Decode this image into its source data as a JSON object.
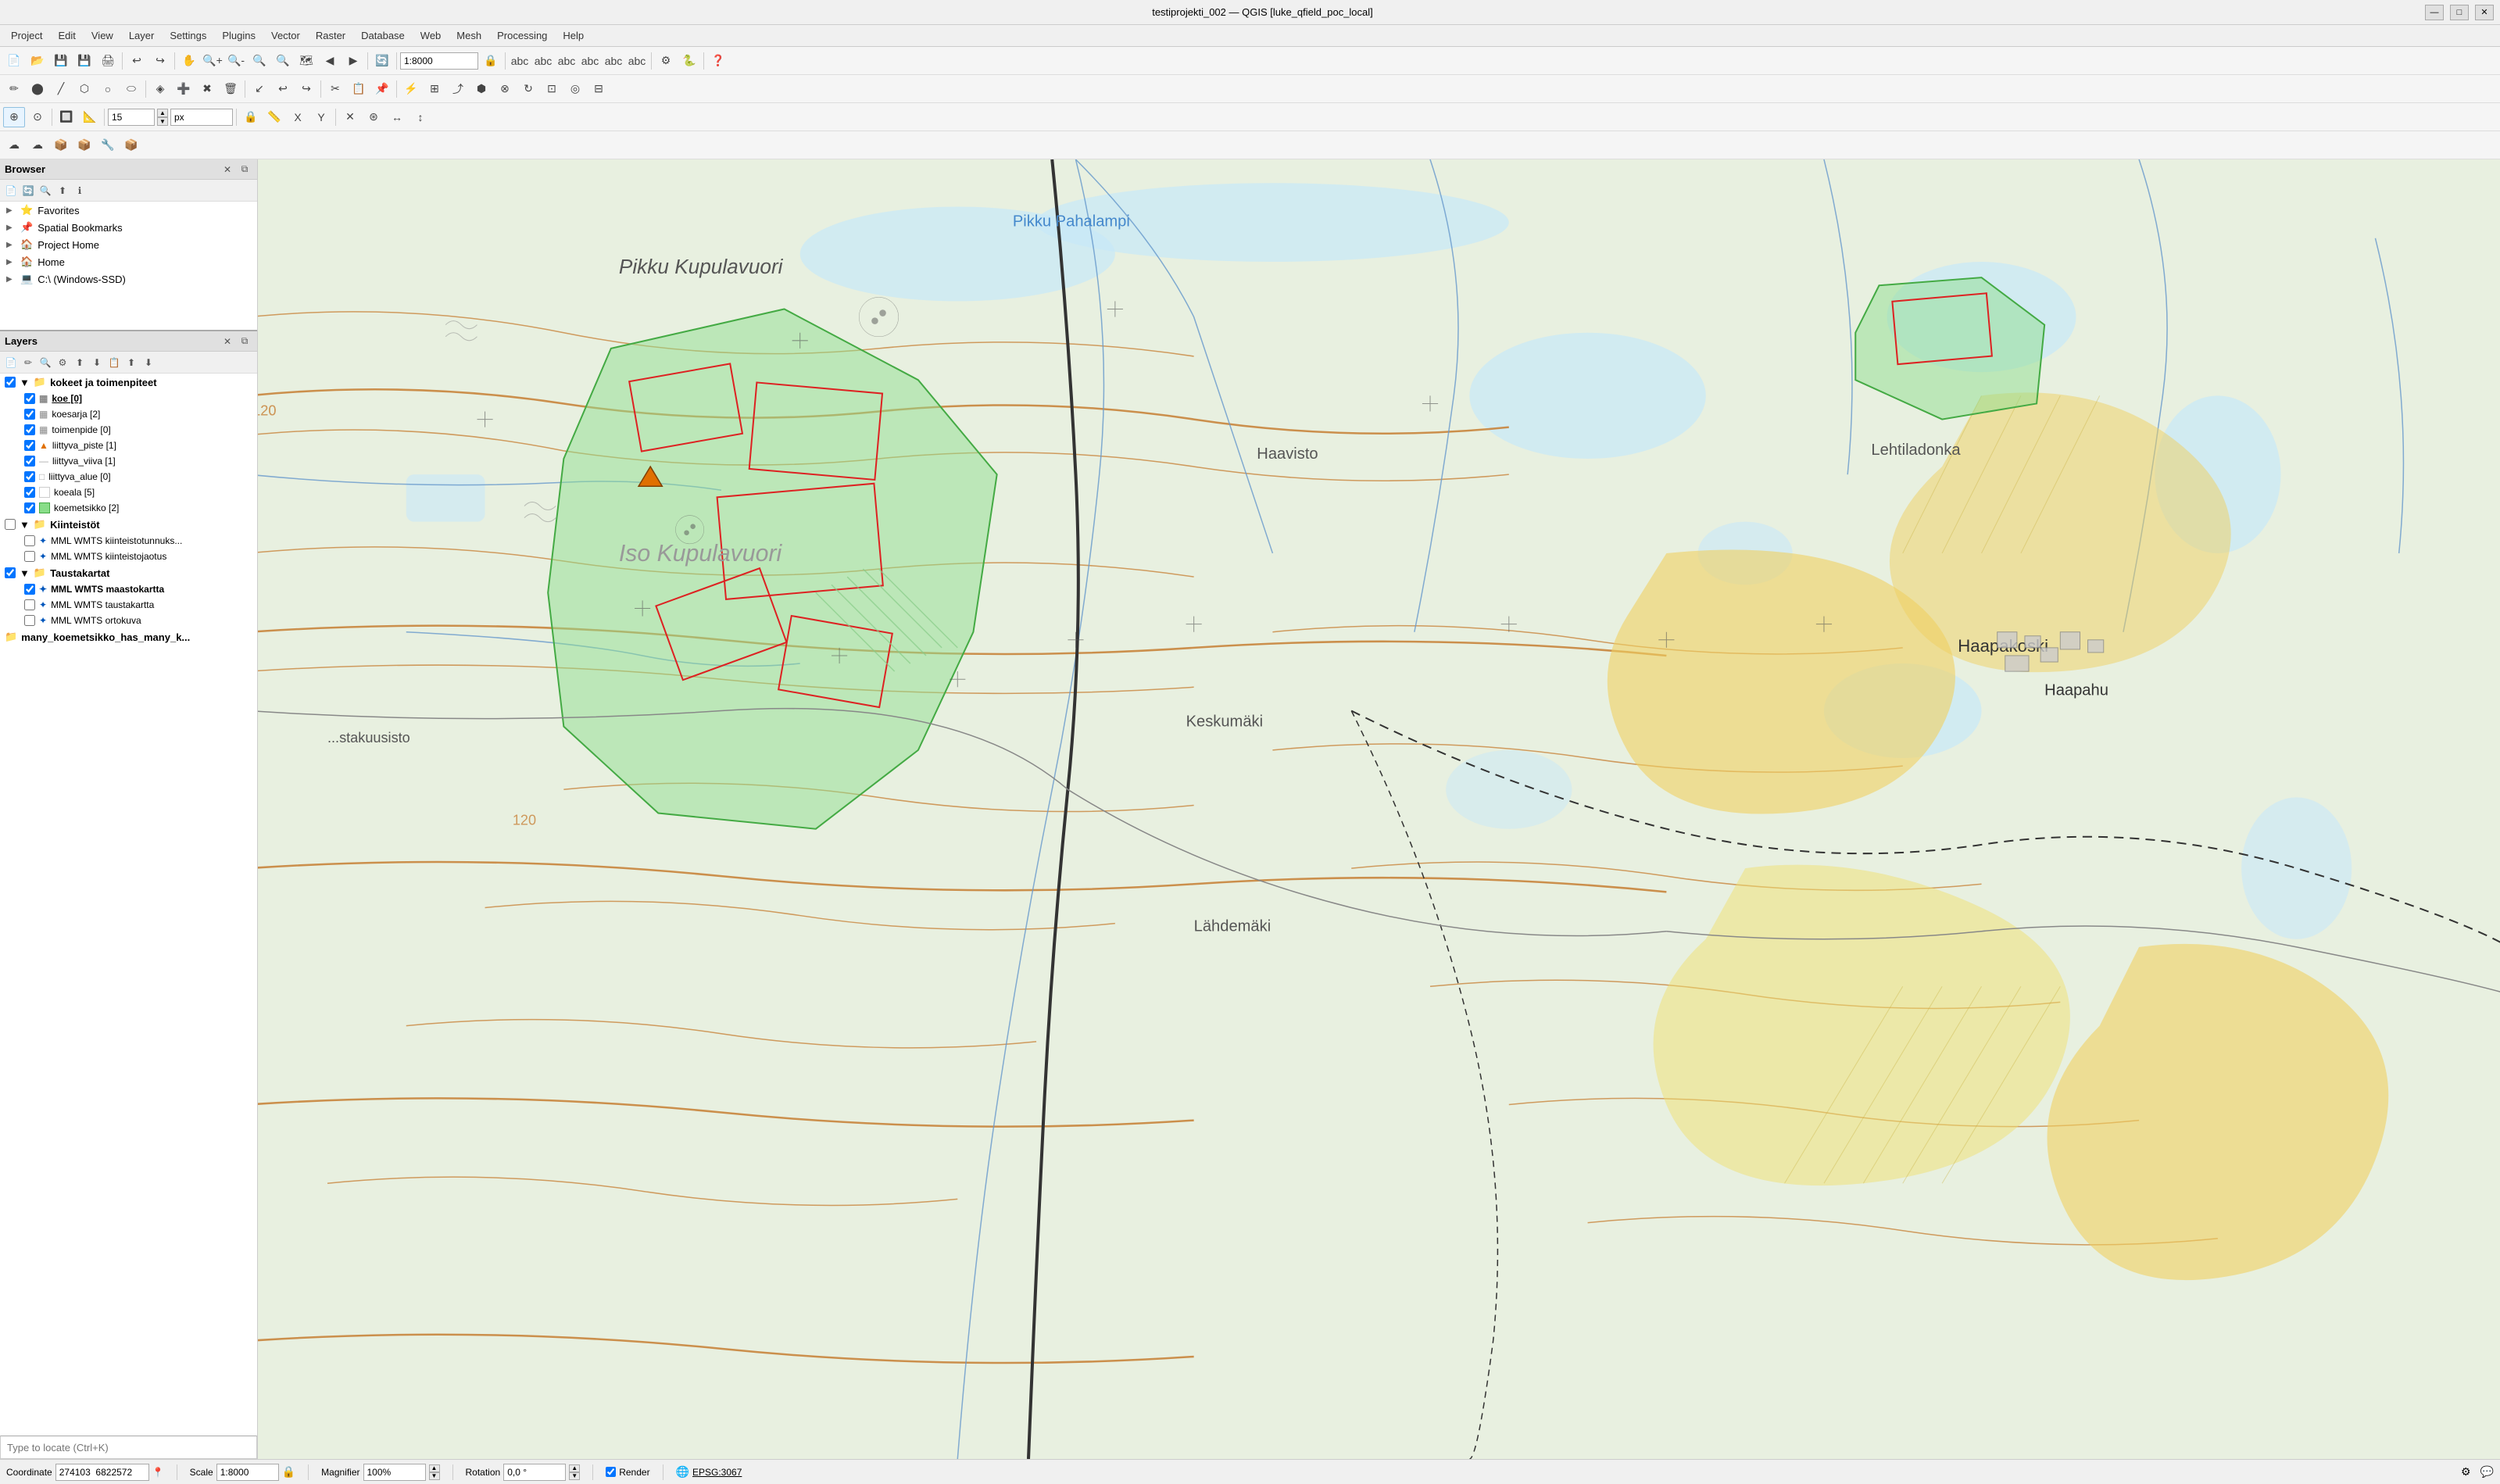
{
  "titlebar": {
    "title": "testiprojekti_002 — QGIS [luke_qfield_poc_local]",
    "min_label": "—",
    "max_label": "□",
    "close_label": "✕"
  },
  "menubar": {
    "items": [
      "Project",
      "Edit",
      "View",
      "Layer",
      "Settings",
      "Plugins",
      "Vector",
      "Raster",
      "Database",
      "Web",
      "Mesh",
      "Processing",
      "Help"
    ]
  },
  "toolbar1": {
    "buttons": [
      "📄",
      "📂",
      "💾",
      "🖨",
      "⚙",
      "↩",
      "↪",
      "🔍",
      "🔍",
      "🔍",
      "🔍",
      "🔍",
      "🔍",
      "🔍",
      "🗺",
      "🔗",
      "⏱",
      "🔄",
      "1:",
      "🔒",
      "🖊",
      "🖊",
      "🔒",
      "🔒",
      "Σ",
      "📊",
      "🖩",
      "💬",
      "🔍"
    ]
  },
  "digitize_toolbar": {
    "buttons": [
      "✏",
      "✂",
      "🖊",
      "🔷",
      "◉",
      "⬡",
      "🔵",
      "⊕",
      "➕",
      "✖",
      "🗑",
      "↙",
      "↩",
      "↪",
      "⌂",
      "∿",
      "📐",
      "📏",
      "🔀",
      "↻",
      "🔗",
      "⊞",
      "◰",
      "🔳",
      "📋"
    ]
  },
  "advanced_toolbar": {
    "num_value": "15",
    "unit_value": "px",
    "buttons": [
      "◉",
      "🔲",
      "📐",
      "⬡",
      "🔷",
      "⊙",
      "⊕",
      "🔗",
      "✂",
      "🖊",
      "⊞",
      "⚙",
      "✕",
      "⊛",
      "↔",
      "↕"
    ]
  },
  "plugins_toolbar": {
    "buttons": [
      "☁",
      "☁",
      "📦",
      "📦",
      "🔧",
      "📦"
    ]
  },
  "browser": {
    "title": "Browser",
    "toolbar_buttons": [
      "📄",
      "🔄",
      "🔍",
      "⬆",
      "ℹ"
    ],
    "items": [
      {
        "label": "Favorites",
        "icon": "⭐",
        "indent": 0
      },
      {
        "label": "Spatial Bookmarks",
        "icon": "📌",
        "indent": 0
      },
      {
        "label": "Project Home",
        "icon": "🏠",
        "indent": 0
      },
      {
        "label": "Home",
        "icon": "🏠",
        "indent": 0
      },
      {
        "label": "C:\\ (Windows-SSD)",
        "icon": "💻",
        "indent": 0
      }
    ]
  },
  "layers": {
    "title": "Layers",
    "toolbar_buttons": [
      "📄",
      "✏",
      "🔍",
      "⚙",
      "⬆",
      "⬇",
      "📋",
      "⬆",
      "⬇"
    ],
    "groups": [
      {
        "label": "kokeet ja toimenpiteet",
        "icon": "📁",
        "checked": true,
        "expanded": true,
        "items": [
          {
            "label": "koe [0]",
            "icon": "table",
            "checked": true,
            "active": true
          },
          {
            "label": "koesarja [2]",
            "icon": "table",
            "checked": true
          },
          {
            "label": "toimenpide [0]",
            "icon": "table",
            "checked": true
          },
          {
            "label": "liittyva_piste [1]",
            "icon": "point",
            "checked": true
          },
          {
            "label": "liittyva_viiva [1]",
            "icon": "line",
            "checked": true
          },
          {
            "label": "liittyva_alue [0]",
            "icon": "polygon",
            "checked": true
          },
          {
            "label": "koeala [5]",
            "icon": "polygon",
            "checked": true
          },
          {
            "label": "koemetsikko [2]",
            "icon": "polygon",
            "checked": true,
            "color": "green"
          }
        ]
      },
      {
        "label": "Kiinteistöt",
        "icon": "📁",
        "checked": false,
        "expanded": true,
        "items": [
          {
            "label": "MML WMTS kiinteistotunnuks...",
            "icon": "wmts",
            "checked": false
          },
          {
            "label": "MML WMTS kiinteistojaotus",
            "icon": "wmts",
            "checked": false
          }
        ]
      },
      {
        "label": "Taustakartat",
        "icon": "📁",
        "checked": true,
        "expanded": true,
        "items": [
          {
            "label": "MML WMTS maastokartta",
            "icon": "wmts",
            "checked": true,
            "bold": true
          },
          {
            "label": "MML WMTS taustakartta",
            "icon": "wmts",
            "checked": false
          },
          {
            "label": "MML WMTS ortokuva",
            "icon": "wmts",
            "checked": false
          }
        ]
      }
    ],
    "extra_item": "many_koemetsikko_has_many_k..."
  },
  "statusbar": {
    "coordinate_label": "Coordinate",
    "coordinate_value": "274103  6822572",
    "scale_label": "Scale",
    "scale_value": "1:8000",
    "magnifier_label": "Magnifier",
    "magnifier_value": "100%",
    "rotation_label": "Rotation",
    "rotation_value": "0,0 °",
    "render_label": "Render",
    "crs_label": "EPSG:3067"
  },
  "locate_placeholder": "Type to locate (Ctrl+K)"
}
